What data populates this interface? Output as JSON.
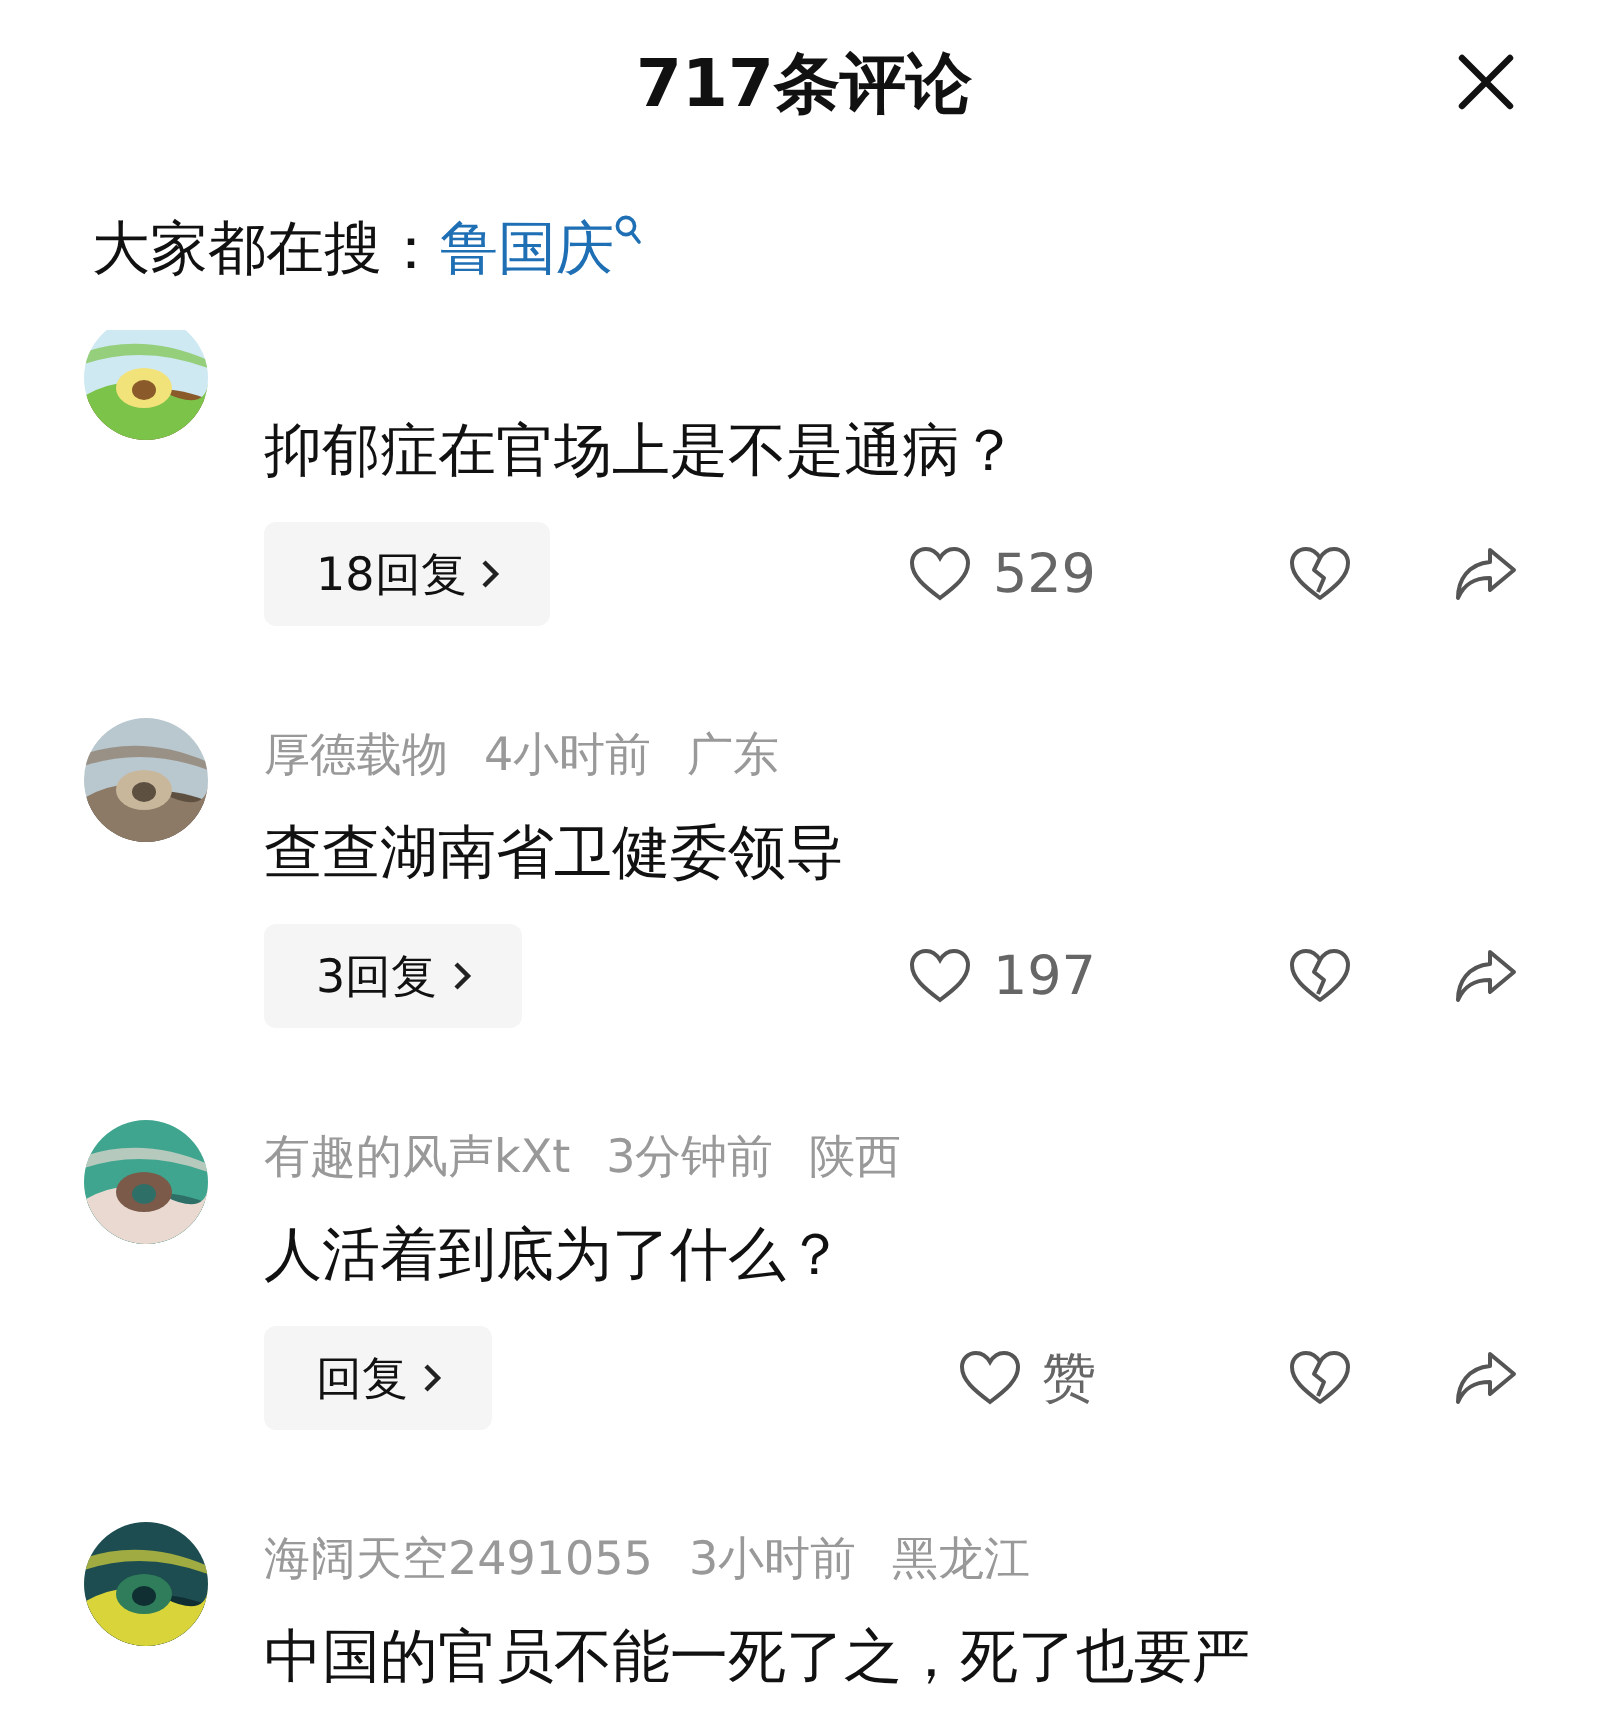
{
  "header": {
    "title": "717条评论"
  },
  "search_hint": {
    "label": "大家都在搜：",
    "term": "鲁国庆"
  },
  "comments": [
    {
      "text": "抑郁症在官场上是不是通病？",
      "replies": "18回复",
      "likes": "529"
    },
    {
      "user": "厚德载物",
      "time": "4小时前",
      "location": "广东",
      "text": "查查湖南省卫健委领导",
      "replies": "3回复",
      "likes": "197"
    },
    {
      "user": "有趣的风声kXt",
      "time": "3分钟前",
      "location": "陕西",
      "text": "人活着到底为了什么？",
      "replies": "回复",
      "likes": "赞"
    },
    {
      "user": "海阔天空2491055",
      "time": "3小时前",
      "location": "黑龙江",
      "text": "中国的官员不能一死了之，死了也要严"
    }
  ]
}
